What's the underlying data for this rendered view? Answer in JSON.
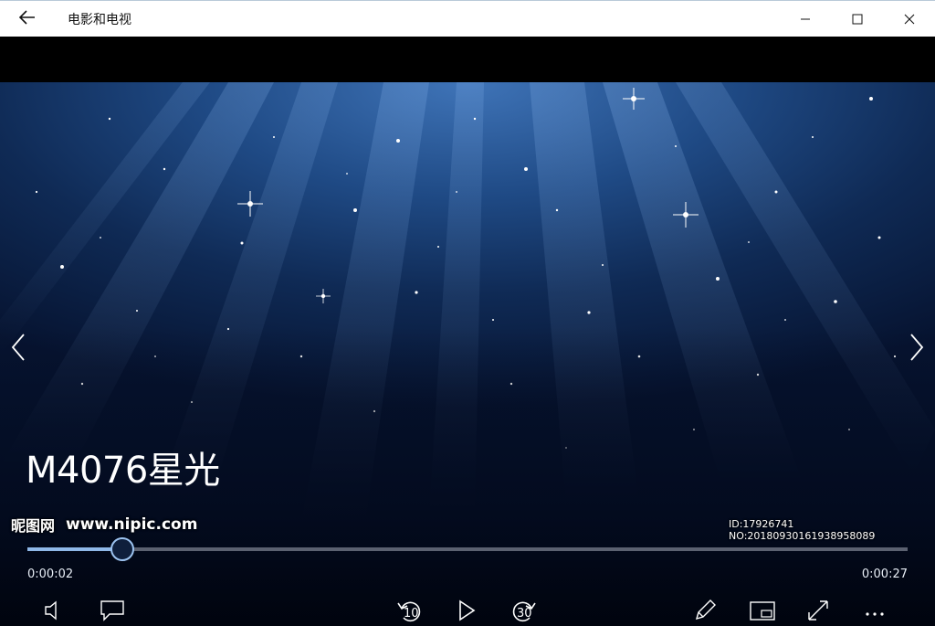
{
  "app": {
    "title": "电影和电视"
  },
  "window_controls": {
    "minimize_icon": "minimize-icon",
    "maximize_icon": "maximize-icon",
    "close_icon": "close-icon"
  },
  "video": {
    "title": "M4076星光",
    "elapsed": "0:00:02",
    "total": "0:00:27",
    "progress_fraction": 0.108
  },
  "controls": {
    "skip_back_seconds": "10",
    "skip_forward_seconds": "30"
  },
  "watermark": {
    "logo_text": "昵图网",
    "site": "www.nipic.com",
    "id_text": "ID:17926741 NO:20180930161938958089"
  },
  "colors": {
    "progress_fill": "#8fb8e8",
    "titlebar_bg": "#ffffff"
  }
}
